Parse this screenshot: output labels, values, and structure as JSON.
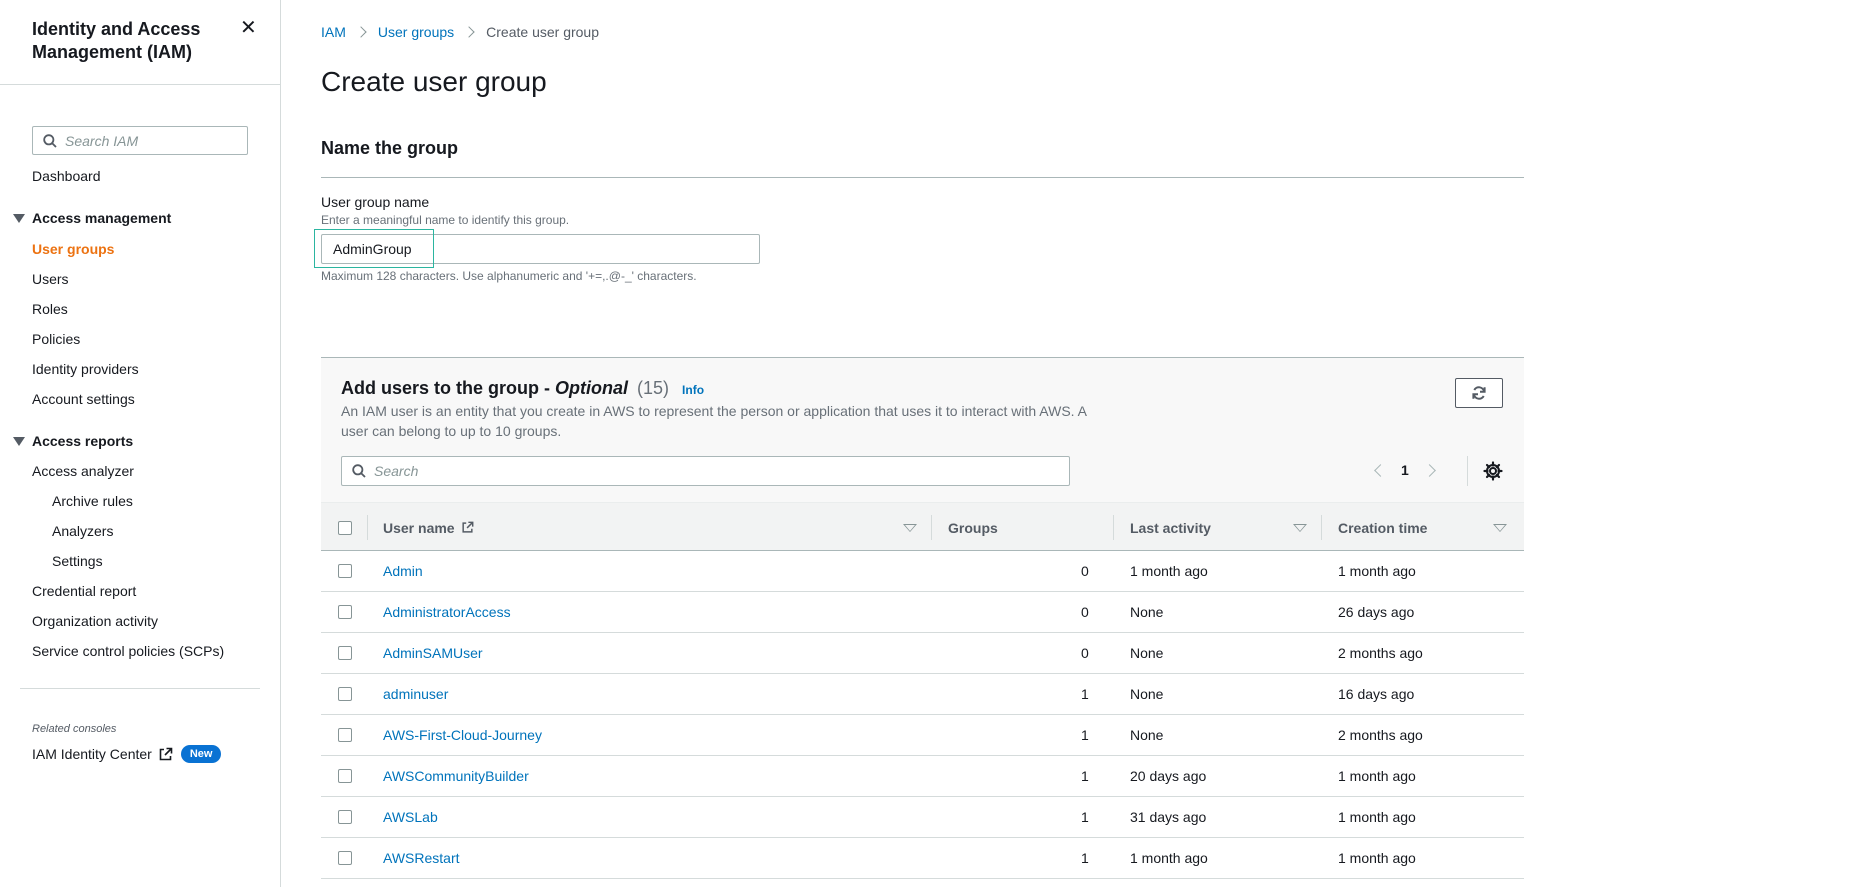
{
  "sidebar": {
    "title": "Identity and Access Management (IAM)",
    "search_placeholder": "Search IAM",
    "dashboard": "Dashboard",
    "access_management": {
      "label": "Access management",
      "items": [
        "User groups",
        "Users",
        "Roles",
        "Policies",
        "Identity providers",
        "Account settings"
      ],
      "active": "User groups"
    },
    "access_reports": {
      "label": "Access reports",
      "access_analyzer": "Access analyzer",
      "analyzer_items": [
        "Archive rules",
        "Analyzers",
        "Settings"
      ],
      "items": [
        "Credential report",
        "Organization activity",
        "Service control policies (SCPs)"
      ]
    },
    "related_consoles_label": "Related consoles",
    "identity_center": "IAM Identity Center",
    "new_badge": "New"
  },
  "breadcrumb": {
    "iam": "IAM",
    "user_groups": "User groups",
    "current": "Create user group"
  },
  "page_title": "Create user group",
  "name_section": {
    "title": "Name the group",
    "field_label": "User group name",
    "field_description": "Enter a meaningful name to identify this group.",
    "field_value": "AdminGroup",
    "constraint": "Maximum 128 characters. Use alphanumeric and '+=,.@-_' characters."
  },
  "users_section": {
    "title_main": "Add users to the group - ",
    "title_optional": "Optional",
    "count": "(15)",
    "info": "Info",
    "description": "An IAM user is an entity that you create in AWS to represent the person or application that uses it to interact with AWS. A user can belong to up to 10 groups.",
    "search_placeholder": "Search",
    "page": "1",
    "columns": {
      "user_name": "User name",
      "groups": "Groups",
      "last_activity": "Last activity",
      "creation_time": "Creation time"
    },
    "rows": [
      {
        "name": "Admin",
        "groups": "0",
        "last_activity": "1 month ago",
        "creation_time": "1 month ago"
      },
      {
        "name": "AdministratorAccess",
        "groups": "0",
        "last_activity": "None",
        "creation_time": "26 days ago"
      },
      {
        "name": "AdminSAMUser",
        "groups": "0",
        "last_activity": "None",
        "creation_time": "2 months ago"
      },
      {
        "name": "adminuser",
        "groups": "1",
        "last_activity": "None",
        "creation_time": "16 days ago"
      },
      {
        "name": "AWS-First-Cloud-Journey",
        "groups": "1",
        "last_activity": "None",
        "creation_time": "2 months ago"
      },
      {
        "name": "AWSCommunityBuilder",
        "groups": "1",
        "last_activity": "20 days ago",
        "creation_time": "1 month ago"
      },
      {
        "name": "AWSLab",
        "groups": "1",
        "last_activity": "31 days ago",
        "creation_time": "1 month ago"
      },
      {
        "name": "AWSRestart",
        "groups": "1",
        "last_activity": "1 month ago",
        "creation_time": "1 month ago"
      }
    ]
  },
  "colors": {
    "link": "#0073bb",
    "active_nav": "#ec7211",
    "badge": "#0972d3",
    "focus_ring": "#2bb5a0"
  }
}
